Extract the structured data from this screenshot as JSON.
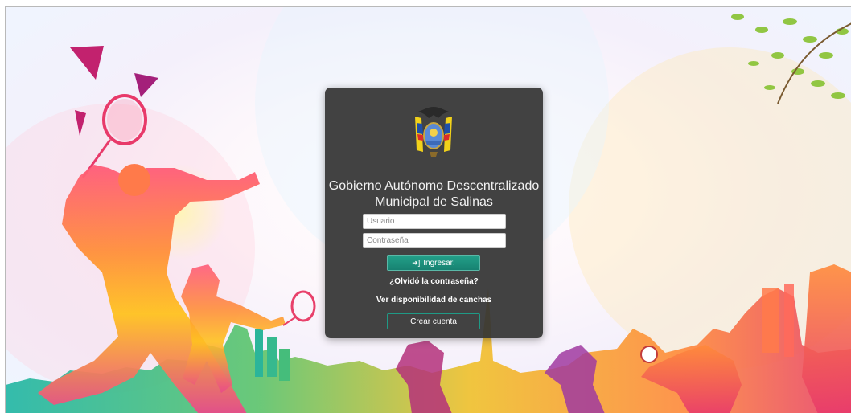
{
  "login": {
    "title_line1": "Gobierno Autónomo Descentralizado",
    "title_line2": "Municipal de Salinas",
    "username_placeholder": "Usuario",
    "password_placeholder": "Contraseña",
    "login_button_label": "Ingresar!",
    "login_button_icon": "sign-in-icon",
    "forgot_password_link": "¿Olvidó la contraseña?",
    "courts_availability_link": "Ver disponibilidad de canchas",
    "create_account_button": "Crear cuenta"
  },
  "logo": {
    "icon": "ecuador-coat-of-arms"
  },
  "colors": {
    "card_background": "#343434",
    "login_button": "#1f9a86",
    "create_button_border": "#1f9a86",
    "title_text": "#f2f2f2"
  }
}
